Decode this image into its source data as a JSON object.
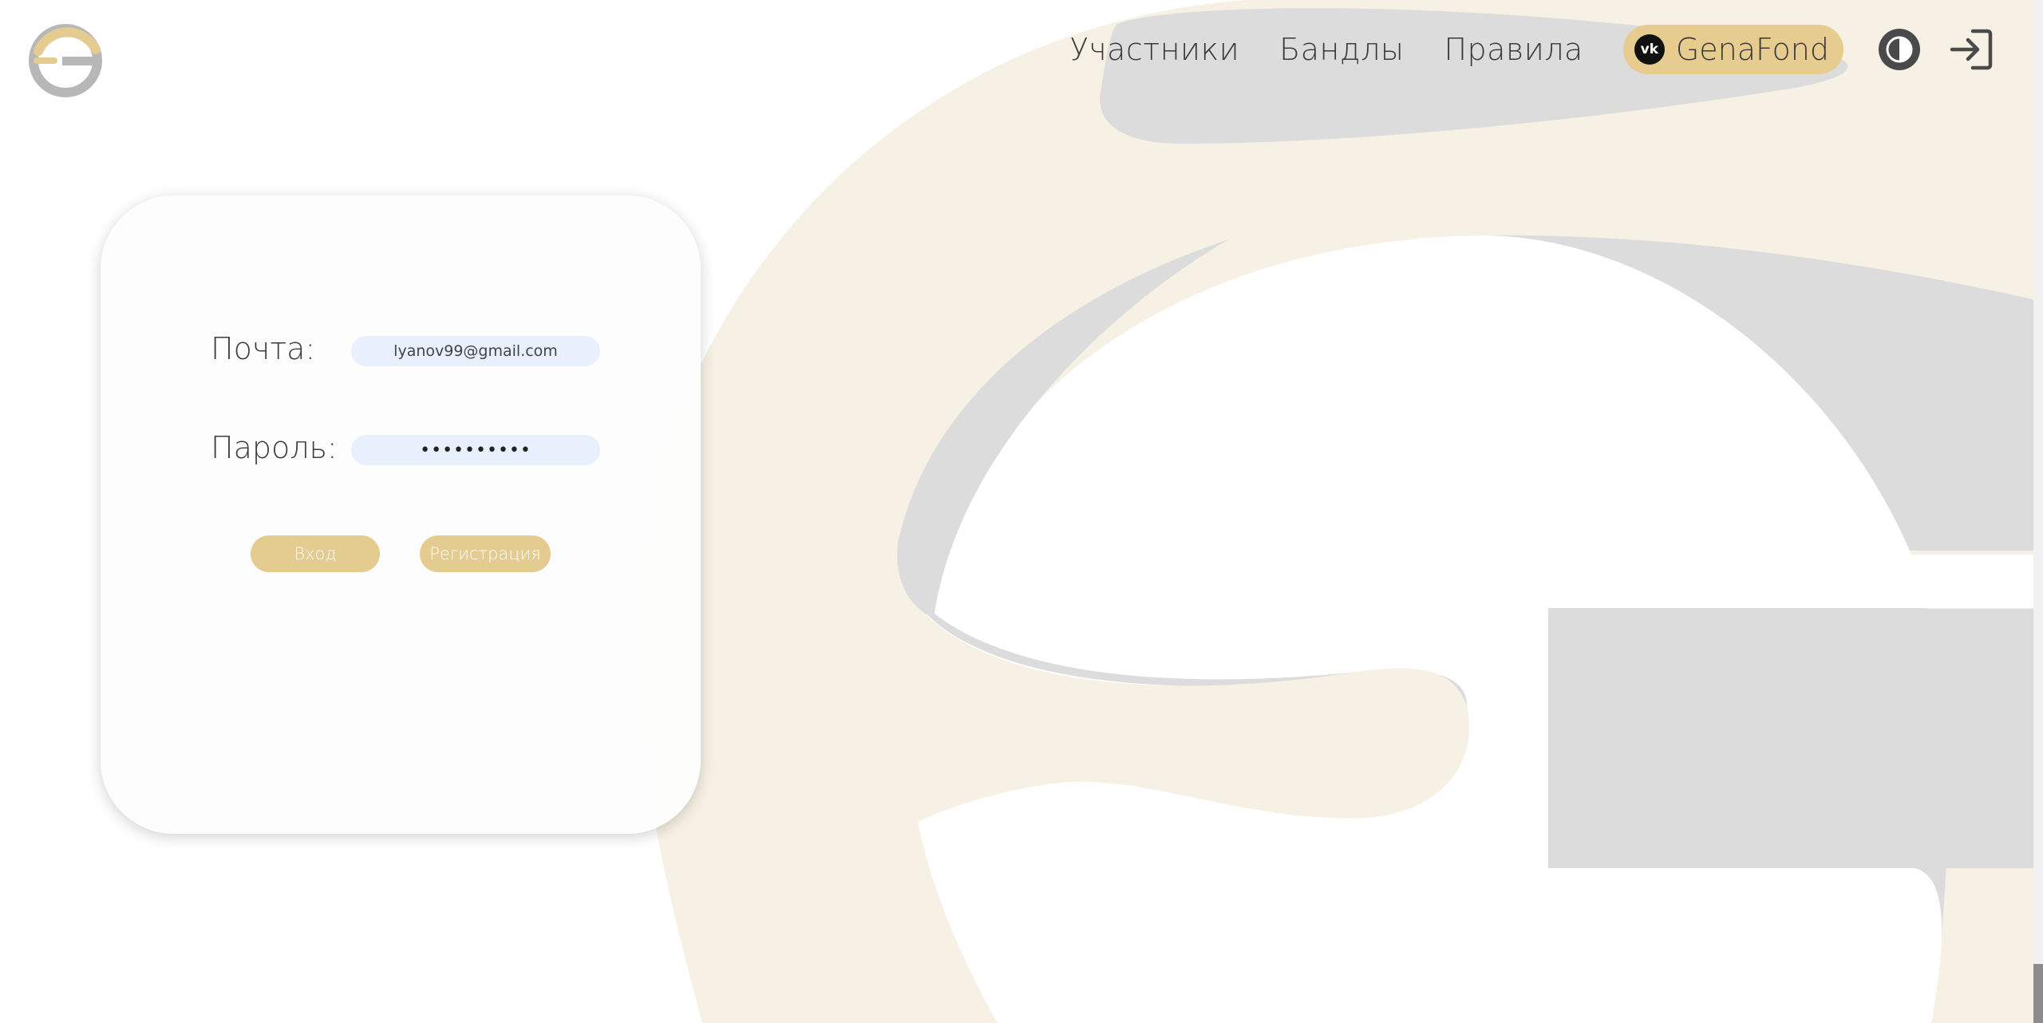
{
  "header": {
    "logo_icon": "genafond-g-logo-icon",
    "nav": [
      {
        "label": "Участники"
      },
      {
        "label": "Бандлы"
      },
      {
        "label": "Правила"
      }
    ],
    "vk_link": {
      "icon_text": "vk",
      "label": "GenaFond"
    },
    "theme_toggle_icon": "contrast-half-circle-icon",
    "login_icon": "sign-in-arrow-icon"
  },
  "login_form": {
    "email_label": "Почта:",
    "email_value": "lyanov99@gmail.com",
    "password_label": "Пароль:",
    "password_value": "••••••••••",
    "login_button": "Вход",
    "register_button": "Регистрация"
  },
  "colors": {
    "accent_gold": "#e4cb8f",
    "background_cream": "#f6f1e4",
    "background_gray": "#dcdcdc",
    "input_bg": "#e8f0fe",
    "text": "#3a3a3a"
  }
}
